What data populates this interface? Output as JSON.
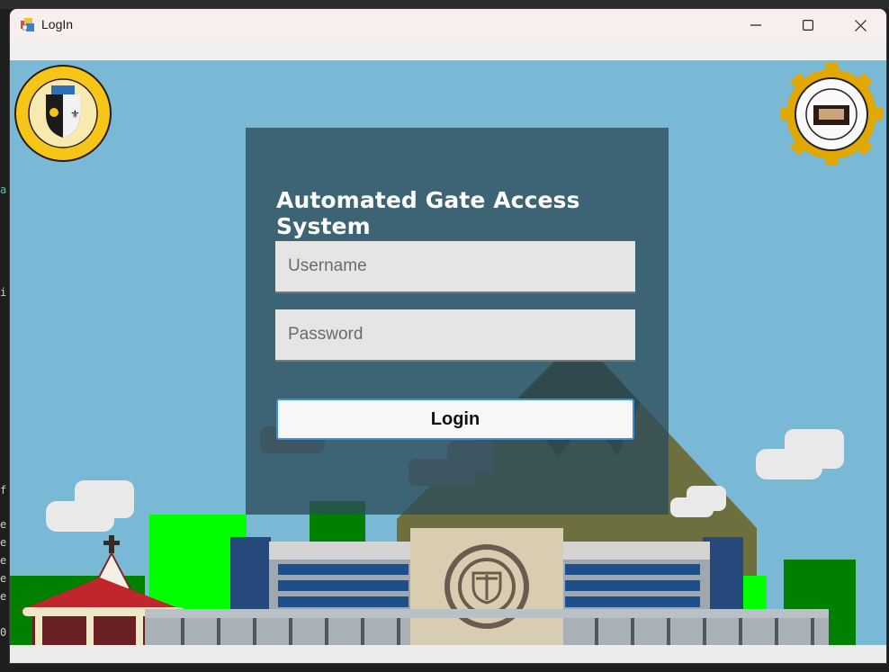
{
  "window": {
    "title": "LogIn"
  },
  "login": {
    "heading": "Automated Gate Access System",
    "username_placeholder": "Username",
    "password_placeholder": "Password",
    "button_label": "Login"
  },
  "colors": {
    "sky": "#79b9d6",
    "panel": "#2d4b5a",
    "button_border": "#3b8fd4",
    "window_title_bg": "#f7eeee"
  },
  "icons": {
    "app": "app-form-icon",
    "minimize": "minimize-icon",
    "maximize": "maximize-icon",
    "close": "close-icon",
    "left_logo": "university-seal-logo",
    "right_logo": "gear-seal-logo"
  }
}
